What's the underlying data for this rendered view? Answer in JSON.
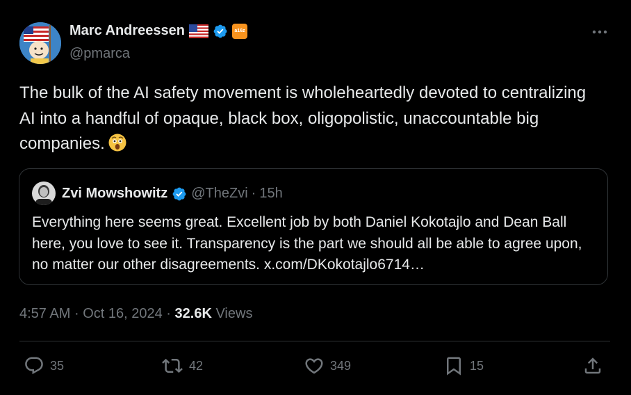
{
  "author": {
    "name": "Marc Andreessen",
    "handle": "@pmarca",
    "affiliation_badge": "a16z"
  },
  "tweet": {
    "text": "The bulk of the AI safety movement is wholeheartedly devoted to centralizing AI into a handful of opaque, black box, oligopolistic, unaccountable big companies.",
    "emoji": "astonished-face"
  },
  "quote": {
    "name": "Zvi Mowshowitz",
    "handle": "@TheZvi",
    "separator": "·",
    "time": "15h",
    "text": "Everything here seems great. Excellent job by both Daniel Kokotajlo and Dean Ball here, you love to see it. Transparency is the part we should all be able to agree upon, no matter our other disagreements. x.com/DKokotajlo6714…"
  },
  "meta": {
    "time": "4:57 AM",
    "date": "Oct 16, 2024",
    "separator": "·",
    "views_count": "32.6K",
    "views_label": "Views"
  },
  "actions": {
    "replies": "35",
    "reposts": "42",
    "likes": "349",
    "bookmarks": "15"
  },
  "colors": {
    "background": "#000000",
    "text": "#e7e9ea",
    "muted": "#71767b",
    "border": "#2f3336",
    "verified": "#1d9bf0"
  }
}
